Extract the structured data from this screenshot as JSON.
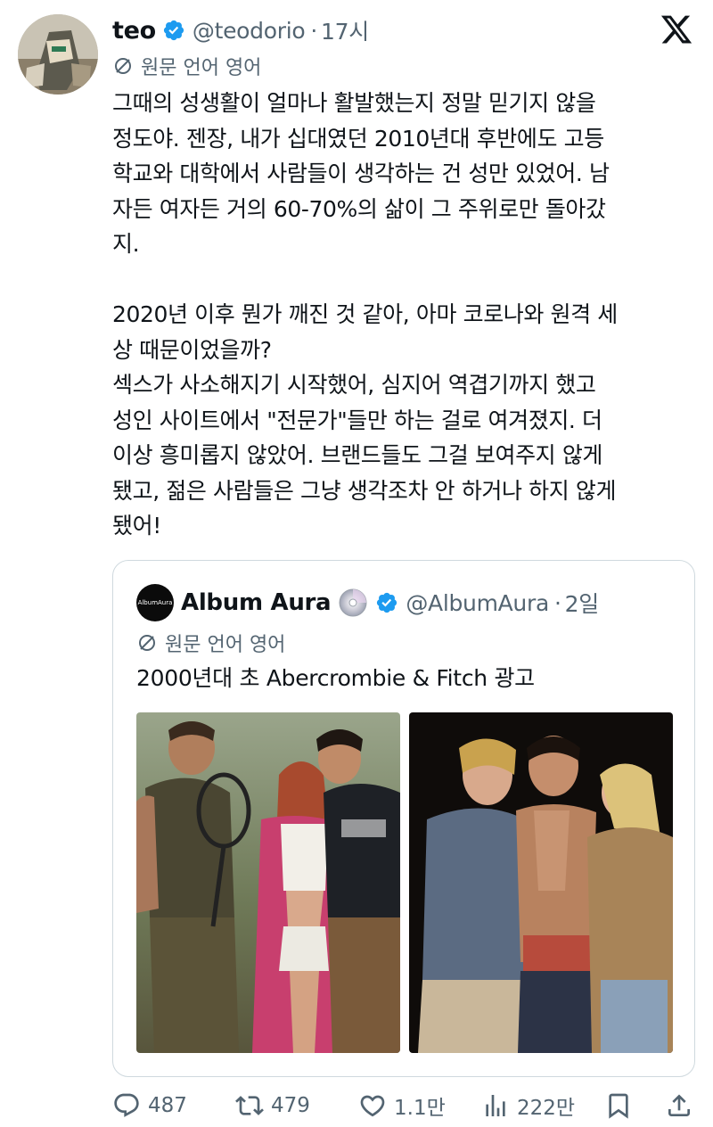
{
  "author": {
    "name": "teo",
    "handle": "@teodorio",
    "separator": "·",
    "time": "17시"
  },
  "translate_label": "원문 언어 영어",
  "tweet_paragraphs": [
    "그때의 성생활이 얼마나 활발했는지 정말 믿기지 않을",
    "정도야. 젠장, 내가 십대였던 2010년대 후반에도 고등",
    "학교와 대학에서 사람들이 생각하는 건 성만 있었어. 남",
    "자든 여자든 거의 60-70%의 삶이 그 주위로만 돌아갔",
    "지.",
    "",
    "2020년 이후 뭔가 깨진 것 같아, 아마 코로나와 원격 세",
    "상 때문이었을까?",
    "섹스가 사소해지기 시작했어, 심지어 역겹기까지 했고",
    "성인 사이트에서 \"전문가\"들만 하는 걸로 여겨졌지. 더",
    "이상 흥미롭지 않았어. 브랜드들도 그걸 보여주지 않게",
    "됐고, 젊은 사람들은 그냥 생각조차 안 하거나 하지 않게",
    "됐어!"
  ],
  "quoted": {
    "avatar_text": "AlbumAura",
    "name": "Album Aura",
    "handle": "@AlbumAura",
    "separator": "·",
    "time": "2일",
    "translate_label": "원문 언어 영어",
    "text": "2000년대 초 Abercrombie & Fitch 광고"
  },
  "actions": {
    "replies": "487",
    "retweets": "479",
    "likes": "1.1만",
    "views": "222만"
  },
  "colors": {
    "text": "#0f1419",
    "secondary": "#536471",
    "verified": "#1d9bf0",
    "border": "#cfd9de"
  }
}
